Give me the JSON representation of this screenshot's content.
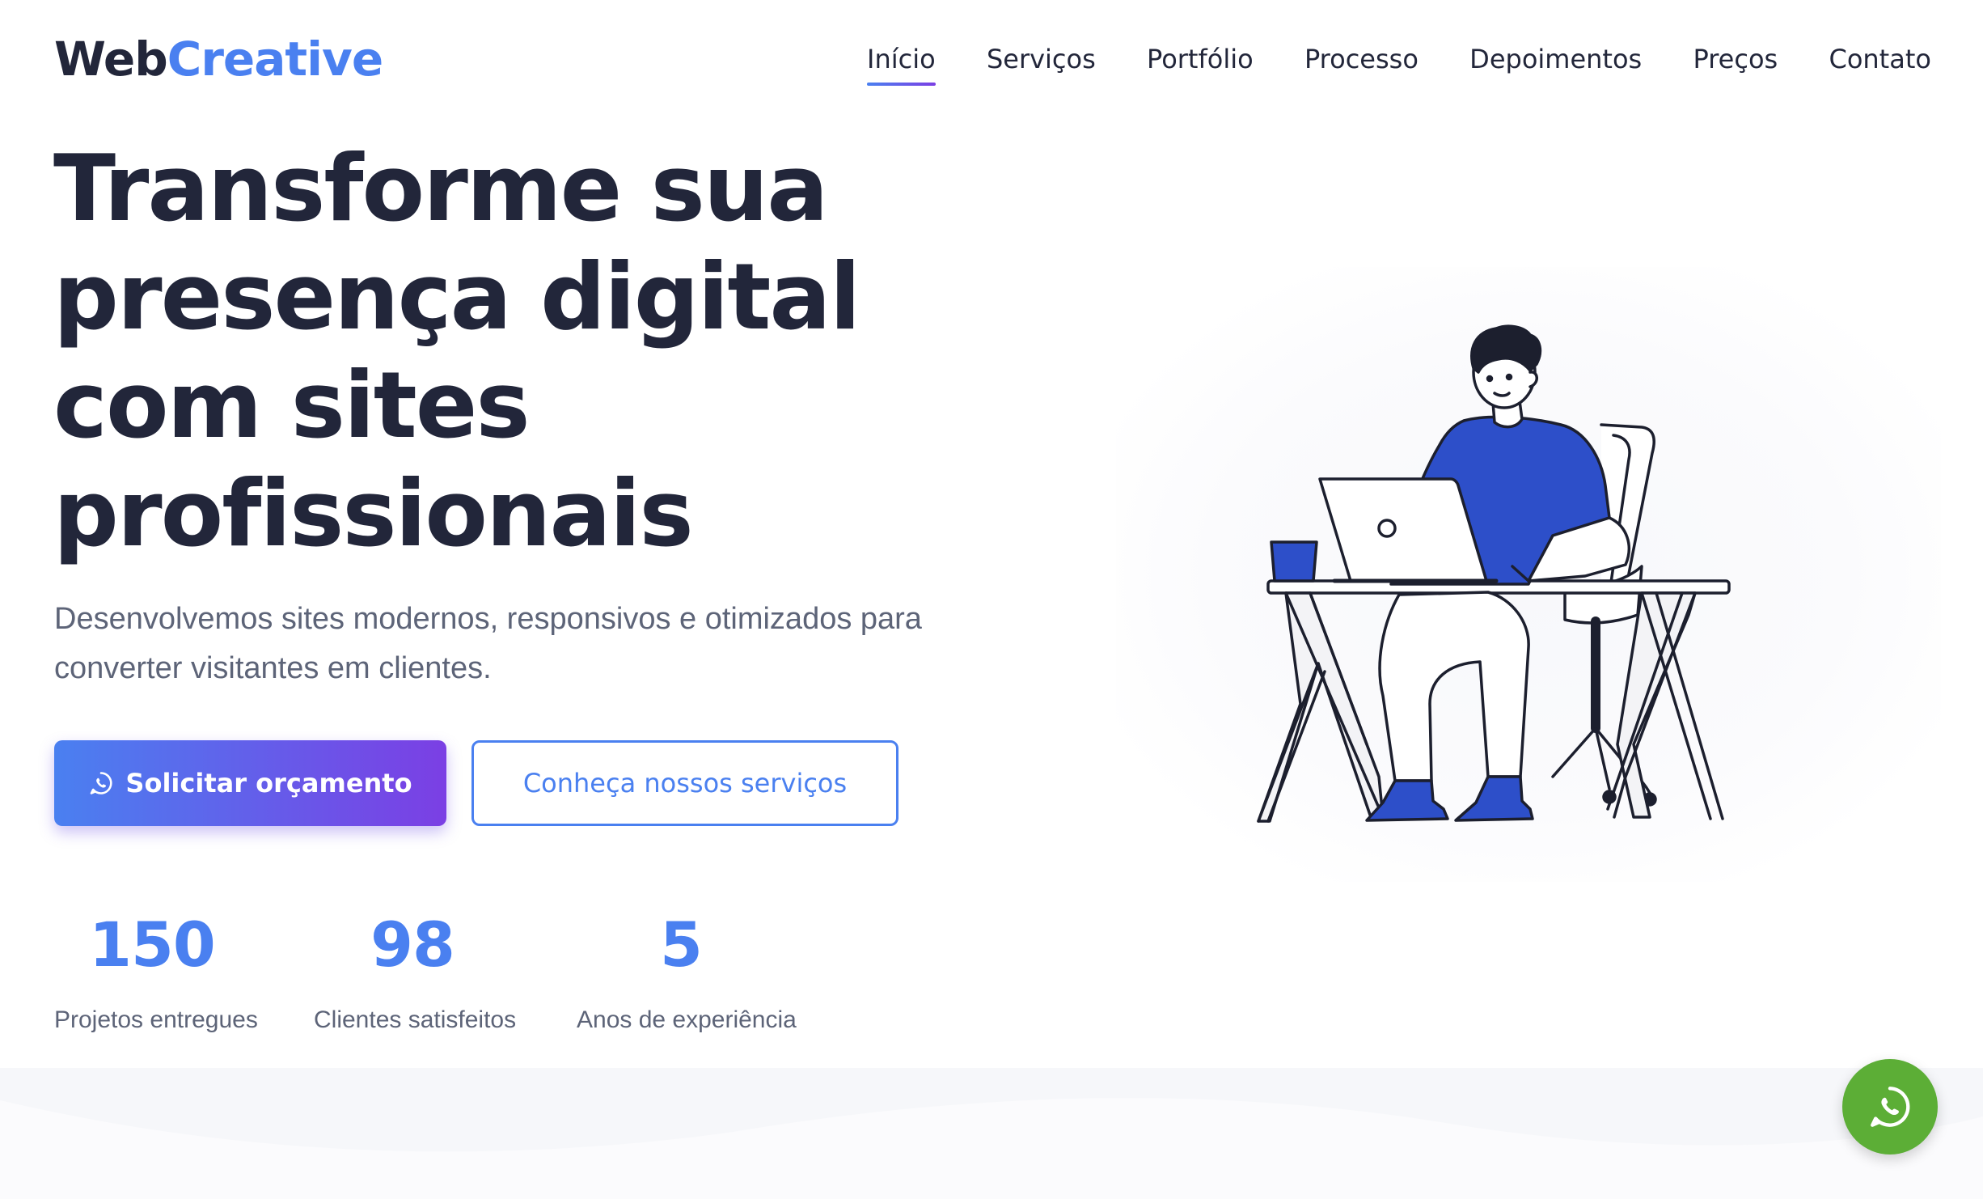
{
  "brand": {
    "part1": "Web",
    "part2": "Creative",
    "color_dark": "#22263a",
    "color_accent": "#4a80f0"
  },
  "nav": {
    "items": [
      {
        "label": "Início",
        "active": true
      },
      {
        "label": "Serviços",
        "active": false
      },
      {
        "label": "Portfólio",
        "active": false
      },
      {
        "label": "Processo",
        "active": false
      },
      {
        "label": "Depoimentos",
        "active": false
      },
      {
        "label": "Preços",
        "active": false
      },
      {
        "label": "Contato",
        "active": false
      }
    ]
  },
  "hero": {
    "headline_lines": [
      "Transforme sua",
      "presença digital",
      "com sites",
      "profissionais"
    ],
    "subtitle_lines": [
      "Desenvolvemos sites modernos, responsivos e otimizados para",
      "converter visitantes em clientes."
    ],
    "primary_cta": {
      "label": "Solicitar orçamento",
      "icon": "whatsapp-icon"
    },
    "secondary_cta": {
      "label": "Conheça nossos serviços"
    }
  },
  "stats": [
    {
      "value": "150",
      "label": "Projetos entregues"
    },
    {
      "value": "98",
      "label": "Clientes satisfeitos"
    },
    {
      "value": "5",
      "label": "Anos de experiência"
    }
  ],
  "illustration": {
    "icon": "person-working-on-laptop-illustration"
  },
  "fab": {
    "icon": "whatsapp-icon",
    "color": "#5cae36"
  },
  "colors": {
    "gradient_start": "#4a80f0",
    "gradient_end": "#7b3fe4",
    "text_muted": "#5d6478",
    "illustration_blue": "#2d4fc9"
  }
}
